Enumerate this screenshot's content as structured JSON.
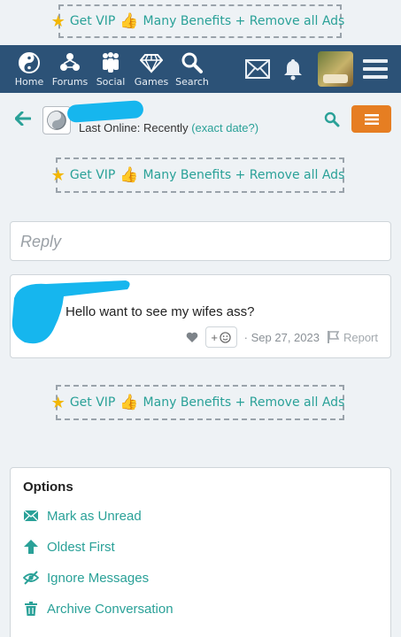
{
  "vip_banner": {
    "get_vip": "Get VIP",
    "text": "Many Benefits + Remove all Ads"
  },
  "nav": {
    "items": [
      {
        "label": "Home",
        "icon": "yin-yang-icon"
      },
      {
        "label": "Forums",
        "icon": "forums-icon"
      },
      {
        "label": "Social",
        "icon": "people-icon"
      },
      {
        "label": "Games",
        "icon": "diamond-icon"
      },
      {
        "label": "Search",
        "icon": "search-icon"
      }
    ]
  },
  "conversation": {
    "last_online": "Last Online: Recently",
    "exact_date": "(exact date?)"
  },
  "reply": {
    "placeholder": "Reply"
  },
  "message": {
    "text": "Hello want to see my wifes ass?",
    "react": "+",
    "date": "· Sep 27, 2023",
    "report": "Report"
  },
  "options": {
    "title": "Options",
    "items": [
      {
        "label": "Mark as Unread",
        "icon": "envelope-icon"
      },
      {
        "label": "Oldest First",
        "icon": "arrow-up-icon"
      },
      {
        "label": "Ignore Messages",
        "icon": "eye-slash-icon"
      },
      {
        "label": "Archive Conversation",
        "icon": "trash-icon"
      }
    ]
  },
  "colors": {
    "navbar": "#2c5277",
    "accent": "#2aa198",
    "menu_button": "#e67e22",
    "redaction": "#16b6ee"
  }
}
